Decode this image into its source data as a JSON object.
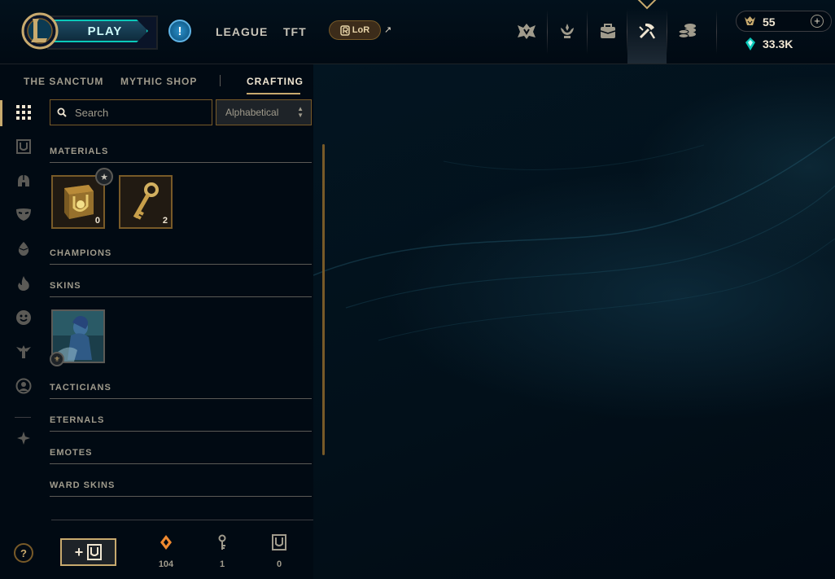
{
  "topbar": {
    "play_label": "PLAY",
    "alert_label": "!",
    "nav": [
      "LEAGUE",
      "TFT"
    ],
    "lor_label": "LoR",
    "external_arrow": "↗",
    "icons": [
      "champions-icon",
      "challenges-icon",
      "collection-icon",
      "loot-icon",
      "store-icon"
    ],
    "active_icon": "loot-icon",
    "currency": {
      "blue_essence_label": "55",
      "riot_points_label": "33.3K",
      "add_label": "+"
    }
  },
  "subnav": {
    "tabs": [
      "THE SANCTUM",
      "MYTHIC SHOP",
      "CRAFTING"
    ],
    "active": "CRAFTING"
  },
  "rail": {
    "icons": [
      "grid-icon",
      "chest-icon",
      "helmet-icon",
      "mask-icon",
      "egg-icon",
      "flame-icon",
      "emote-face-icon",
      "tactician-icon",
      "profile-icon",
      "ward-icon"
    ],
    "help_label": "?"
  },
  "filters": {
    "search_placeholder": "Search",
    "sort_value": "Alphabetical",
    "sort_arrows": "▲▼"
  },
  "sections": {
    "materials": {
      "title": "MATERIALS",
      "items": [
        {
          "name": "Masterwork Chest",
          "count": "0",
          "badge": "★"
        },
        {
          "name": "Hextech Key",
          "count": "2"
        }
      ]
    },
    "champions": {
      "title": "CHAMPIONS"
    },
    "skins": {
      "title": "SKINS",
      "items": [
        {
          "name": "Skin shard",
          "badge": "⚜"
        }
      ]
    },
    "tacticians": {
      "title": "TACTICIANS"
    },
    "eternals": {
      "title": "ETERNALS"
    },
    "emotes": {
      "title": "EMOTES"
    },
    "ward_skins": {
      "title": "WARD SKINS"
    }
  },
  "bottom": {
    "add_chest_label": "+",
    "stats": [
      {
        "icon": "orange-essence-icon",
        "value": "104"
      },
      {
        "icon": "key-fragment-icon",
        "value": "1"
      },
      {
        "icon": "chest-icon",
        "value": "0"
      }
    ]
  },
  "colors": {
    "gold": "#c8aa6e",
    "gold_dark": "#785a28",
    "teal": "#0ac8b9",
    "background": "#010a13",
    "orange_essence": "#f08a30"
  }
}
